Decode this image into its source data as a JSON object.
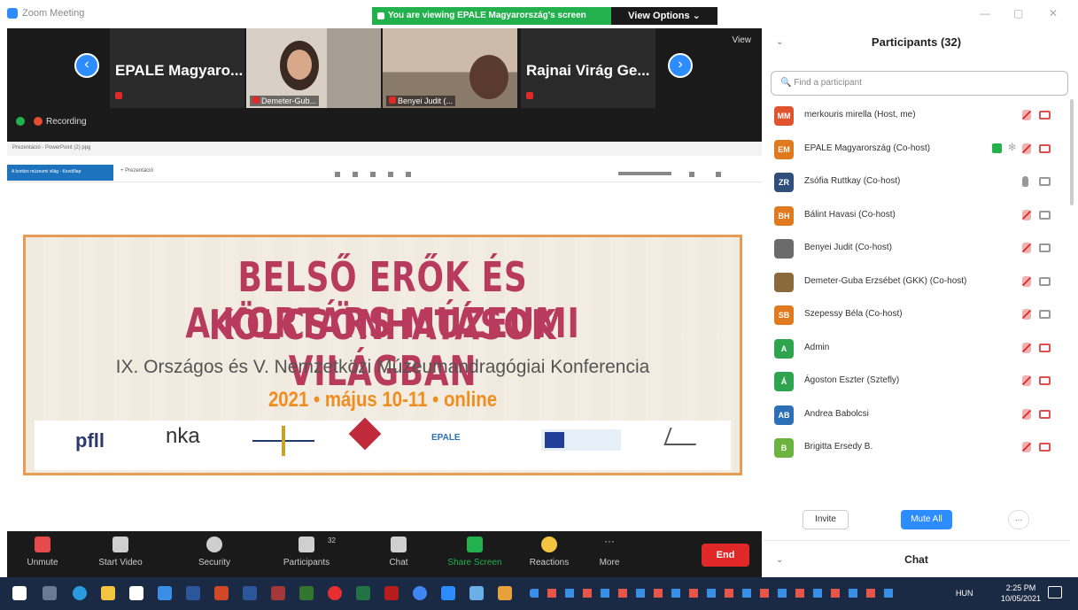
{
  "window": {
    "title": "Zoom Meeting"
  },
  "banner": {
    "text": "You are viewing EPALE Magyarország's screen",
    "view_options": "View Options ⌄"
  },
  "strip": {
    "tiles": [
      {
        "name": "EPALE Magyaro..."
      },
      {
        "label": "Demeter-Gub..."
      },
      {
        "label": "Benyei Judit (..."
      },
      {
        "name": "Rajnai Virág Ge..."
      }
    ],
    "view": "View",
    "recording": "Recording"
  },
  "slide": {
    "window_title": "Prezentáció - PowerPoint (2) ppg",
    "tab_active": "A kortárs múzeumi világ - Kezdőlap",
    "tab_new": "+ Prezentáció",
    "line1": "BELSŐ ERŐK ÉS KÖLCSÖNHATÁSOK",
    "line2": "A KORTÁRS MÚZEUMI VILÁGBAN",
    "subtitle": "IX. Országos és V. Nemzetközi Múzeumandragógiai Konferencia",
    "date": "2021 • május 10-11 • online",
    "logos": [
      "pfll",
      "nka",
      "",
      "",
      "EPALE",
      "",
      ""
    ]
  },
  "controls": {
    "unmute": "Unmute",
    "start_video": "Start Video",
    "security": "Security",
    "participants": "Participants",
    "participants_count": "32",
    "chat": "Chat",
    "share": "Share Screen",
    "reactions": "Reactions",
    "more": "More",
    "end": "End"
  },
  "panel": {
    "title": "Participants (32)",
    "search_placeholder": "Find a participant",
    "invite": "Invite",
    "mute_all": "Mute All",
    "more": "...",
    "chat_title": "Chat"
  },
  "participants": [
    {
      "initials": "MM",
      "name": "merkouris mirella (Host, me)",
      "color": "#e0532e",
      "mic": "muted",
      "cam": "off"
    },
    {
      "initials": "EM",
      "name": "EPALE Magyarország (Co-host)",
      "color": "#e07a1e",
      "mic": "muted",
      "cam": "off",
      "sharing": true
    },
    {
      "initials": "ZR",
      "name": "Zsófia Ruttkay (Co-host)",
      "color": "#2f4f7a",
      "mic": "on",
      "cam": "on"
    },
    {
      "initials": "BH",
      "name": "Bálint Havasi (Co-host)",
      "color": "#e07a1e",
      "mic": "muted",
      "cam": "on"
    },
    {
      "initials": "",
      "name": "Benyei Judit (Co-host)",
      "color": "#6b6b6b",
      "mic": "muted",
      "cam": "on"
    },
    {
      "initials": "",
      "name": "Demeter-Guba Erzsébet (GKK) (Co-host)",
      "color": "#8a6a3a",
      "mic": "muted",
      "cam": "on"
    },
    {
      "initials": "SB",
      "name": "Szepessy Béla (Co-host)",
      "color": "#e07a1e",
      "mic": "muted",
      "cam": "on"
    },
    {
      "initials": "A",
      "name": "Admin",
      "color": "#2ea44f",
      "mic": "muted",
      "cam": "off"
    },
    {
      "initials": "Á",
      "name": "Ágoston Eszter (Sztefly)",
      "color": "#2ea44f",
      "mic": "muted",
      "cam": "off"
    },
    {
      "initials": "AB",
      "name": "Andrea Babolcsi",
      "color": "#2d6fb6",
      "mic": "muted",
      "cam": "off"
    },
    {
      "initials": "B",
      "name": "Brigitta Ersedy B.",
      "color": "#6cb33f",
      "mic": "muted",
      "cam": "off"
    }
  ],
  "taskbar": {
    "lang": "HUN",
    "time": "2:25 PM",
    "date": "10/05/2021"
  }
}
